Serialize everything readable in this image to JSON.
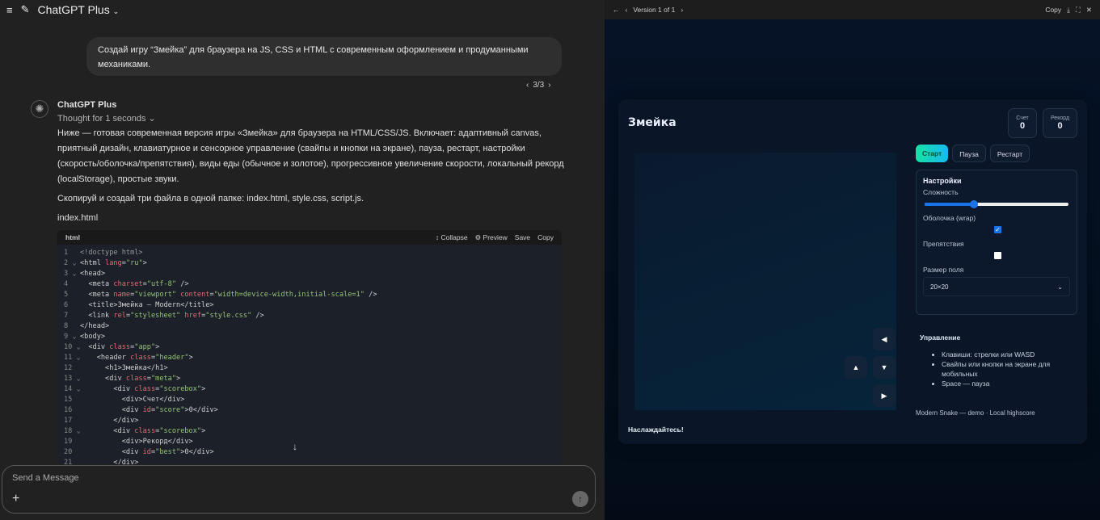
{
  "header": {
    "title": "ChatGPT Plus",
    "menu_icon": "menu-icon",
    "new_chat_icon": "edit-icon"
  },
  "user_message": "Создай игру “Змейка” для браузера на JS, CSS и HTML с современным оформлением и продуманными механиками.",
  "pager": {
    "label": "3/3"
  },
  "assistant": {
    "name": "ChatGPT Plus",
    "thought": "Thought for 1 seconds",
    "paragraphs": [
      "Ниже — готовая современная версия игры «Змейка» для браузера на HTML/CSS/JS. Включает: адаптивный canvas, приятный дизайн, клавиатурное и сенсорное управление (свайпы и кнопки на экране), пауза, рестарт, настройки (скорость/оболочка/препятствия), виды еды (обычное и золотое), прогрессивное увеличение скорости, локальный рекорд (localStorage), простые звуки.",
      "Скопируй и создай три файла в одной папке: index.html, style.css, script.js.",
      "index.html"
    ]
  },
  "code": {
    "lang": "html",
    "collapse": "Collapse",
    "preview": "Preview",
    "save": "Save",
    "copy": "Copy",
    "lines": [
      {
        "n": "1",
        "f": "",
        "s": [
          [
            "gray",
            "<!doctype html>"
          ]
        ]
      },
      {
        "n": "2",
        "f": "v",
        "s": [
          [
            "tag",
            "<html "
          ],
          [
            "attr",
            "lang"
          ],
          [
            "tag",
            "="
          ],
          [
            "str",
            "\"ru\""
          ],
          [
            "tag",
            ">"
          ]
        ]
      },
      {
        "n": "3",
        "f": "v",
        "s": [
          [
            "tag",
            "<head>"
          ]
        ]
      },
      {
        "n": "4",
        "f": "",
        "s": [
          [
            "tag",
            "  <meta "
          ],
          [
            "attr",
            "charset"
          ],
          [
            "tag",
            "="
          ],
          [
            "str",
            "\"utf-8\""
          ],
          [
            "tag",
            " />"
          ]
        ]
      },
      {
        "n": "5",
        "f": "",
        "s": [
          [
            "tag",
            "  <meta "
          ],
          [
            "attr",
            "name"
          ],
          [
            "tag",
            "="
          ],
          [
            "str",
            "\"viewport\" "
          ],
          [
            "attr",
            "content"
          ],
          [
            "tag",
            "="
          ],
          [
            "str",
            "\"width=device-width,initial-scale=1\""
          ],
          [
            "tag",
            " />"
          ]
        ]
      },
      {
        "n": "6",
        "f": "",
        "s": [
          [
            "tag",
            "  <title>"
          ],
          [
            "txt",
            "Змейка — Modern"
          ],
          [
            "tag",
            "</title>"
          ]
        ]
      },
      {
        "n": "7",
        "f": "",
        "s": [
          [
            "tag",
            "  <link "
          ],
          [
            "attr",
            "rel"
          ],
          [
            "tag",
            "="
          ],
          [
            "str",
            "\"stylesheet\" "
          ],
          [
            "attr",
            "href"
          ],
          [
            "tag",
            "="
          ],
          [
            "str",
            "\"style.css\""
          ],
          [
            "tag",
            " />"
          ]
        ]
      },
      {
        "n": "8",
        "f": "",
        "s": [
          [
            "tag",
            "</head>"
          ]
        ]
      },
      {
        "n": "9",
        "f": "v",
        "s": [
          [
            "tag",
            "<body>"
          ]
        ]
      },
      {
        "n": "10",
        "f": "v",
        "s": [
          [
            "tag",
            "  <div "
          ],
          [
            "attr",
            "class"
          ],
          [
            "tag",
            "="
          ],
          [
            "str",
            "\"app\""
          ],
          [
            "tag",
            ">"
          ]
        ]
      },
      {
        "n": "11",
        "f": "v",
        "s": [
          [
            "tag",
            "    <header "
          ],
          [
            "attr",
            "class"
          ],
          [
            "tag",
            "="
          ],
          [
            "str",
            "\"header\""
          ],
          [
            "tag",
            ">"
          ]
        ]
      },
      {
        "n": "12",
        "f": "",
        "s": [
          [
            "tag",
            "      <h1>"
          ],
          [
            "txt",
            "Змейка"
          ],
          [
            "tag",
            "</h1>"
          ]
        ]
      },
      {
        "n": "13",
        "f": "v",
        "s": [
          [
            "tag",
            "      <div "
          ],
          [
            "attr",
            "class"
          ],
          [
            "tag",
            "="
          ],
          [
            "str",
            "\"meta\""
          ],
          [
            "tag",
            ">"
          ]
        ]
      },
      {
        "n": "14",
        "f": "v",
        "s": [
          [
            "tag",
            "        <div "
          ],
          [
            "attr",
            "class"
          ],
          [
            "tag",
            "="
          ],
          [
            "str",
            "\"scorebox\""
          ],
          [
            "tag",
            ">"
          ]
        ]
      },
      {
        "n": "15",
        "f": "",
        "s": [
          [
            "tag",
            "          <div>"
          ],
          [
            "txt",
            "Счет"
          ],
          [
            "tag",
            "</div>"
          ]
        ]
      },
      {
        "n": "16",
        "f": "",
        "s": [
          [
            "tag",
            "          <div "
          ],
          [
            "attr",
            "id"
          ],
          [
            "tag",
            "="
          ],
          [
            "str",
            "\"score\""
          ],
          [
            "tag",
            ">"
          ],
          [
            "txt",
            "0"
          ],
          [
            "tag",
            "</div>"
          ]
        ]
      },
      {
        "n": "17",
        "f": "",
        "s": [
          [
            "tag",
            "        </div>"
          ]
        ]
      },
      {
        "n": "18",
        "f": "v",
        "s": [
          [
            "tag",
            "        <div "
          ],
          [
            "attr",
            "class"
          ],
          [
            "tag",
            "="
          ],
          [
            "str",
            "\"scorebox\""
          ],
          [
            "tag",
            ">"
          ]
        ]
      },
      {
        "n": "19",
        "f": "",
        "s": [
          [
            "tag",
            "          <div>"
          ],
          [
            "txt",
            "Рекорд"
          ],
          [
            "tag",
            "</div>"
          ]
        ]
      },
      {
        "n": "20",
        "f": "",
        "s": [
          [
            "tag",
            "          <div "
          ],
          [
            "attr",
            "id"
          ],
          [
            "tag",
            "="
          ],
          [
            "str",
            "\"best\""
          ],
          [
            "tag",
            ">"
          ],
          [
            "txt",
            "0"
          ],
          [
            "tag",
            "</div>"
          ]
        ]
      },
      {
        "n": "21",
        "f": "",
        "s": [
          [
            "tag",
            "        </div>"
          ]
        ]
      }
    ]
  },
  "composer": {
    "placeholder": "Send a Message"
  },
  "preview_bar": {
    "version": "Version 1 of 1",
    "copy": "Copy"
  },
  "game": {
    "title": "Змейка",
    "score_label": "Счет",
    "score": "0",
    "best_label": "Рекорд",
    "best": "0",
    "start": "Старт",
    "pause": "Пауза",
    "restart": "Рестарт",
    "settings": {
      "title": "Настройки",
      "difficulty": "Сложность",
      "difficulty_value": 0.34,
      "wrap": "Оболочка (wrap)",
      "wrap_checked": true,
      "obstacles": "Препятствия",
      "obstacles_checked": false,
      "size_label": "Размер поля",
      "size_value": "20×20"
    },
    "controls": {
      "title": "Управление",
      "items": [
        "Клавиши: стрелки или WASD",
        "Свайпы или кнопки на экране для мобильных",
        "Space — пауза"
      ]
    },
    "footer": "Modern Snake — demo · Local highscore",
    "enjoy": "Наслаждайтесь!"
  }
}
